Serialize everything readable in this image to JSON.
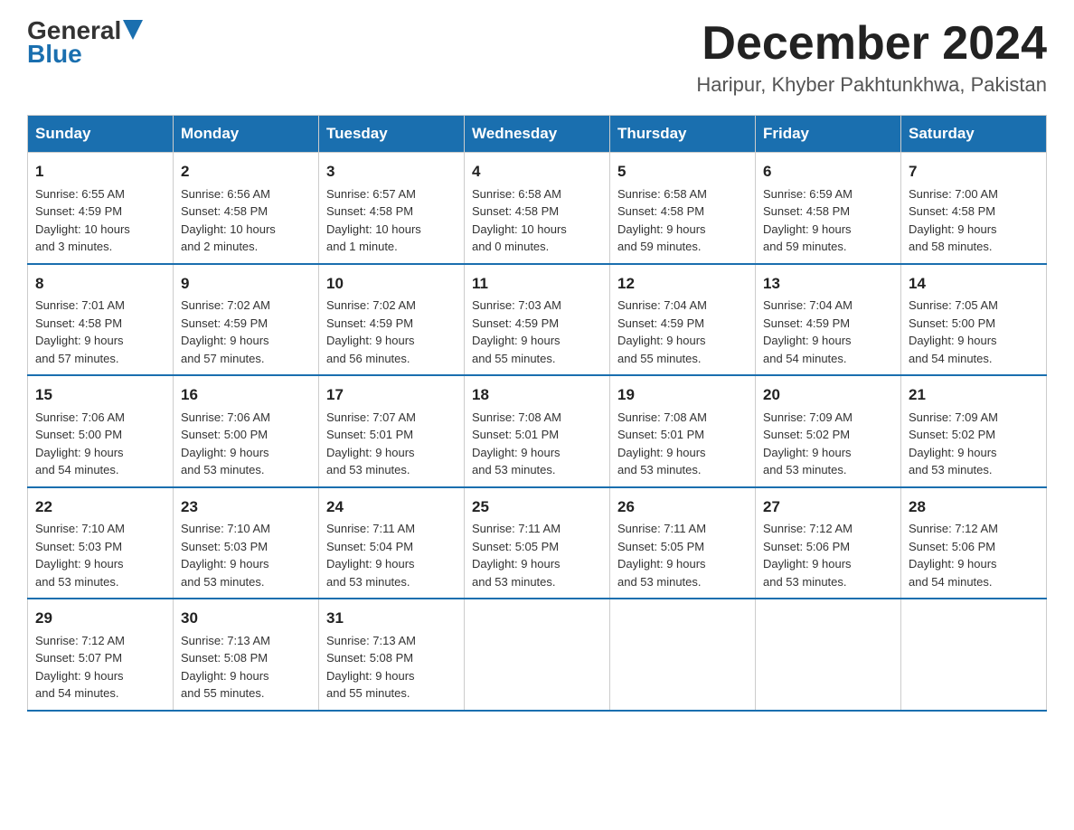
{
  "header": {
    "logo_general": "General",
    "logo_blue": "Blue",
    "month_title": "December 2024",
    "location": "Haripur, Khyber Pakhtunkhwa, Pakistan"
  },
  "days_of_week": [
    "Sunday",
    "Monday",
    "Tuesday",
    "Wednesday",
    "Thursday",
    "Friday",
    "Saturday"
  ],
  "weeks": [
    [
      {
        "day": "1",
        "info": "Sunrise: 6:55 AM\nSunset: 4:59 PM\nDaylight: 10 hours\nand 3 minutes."
      },
      {
        "day": "2",
        "info": "Sunrise: 6:56 AM\nSunset: 4:58 PM\nDaylight: 10 hours\nand 2 minutes."
      },
      {
        "day": "3",
        "info": "Sunrise: 6:57 AM\nSunset: 4:58 PM\nDaylight: 10 hours\nand 1 minute."
      },
      {
        "day": "4",
        "info": "Sunrise: 6:58 AM\nSunset: 4:58 PM\nDaylight: 10 hours\nand 0 minutes."
      },
      {
        "day": "5",
        "info": "Sunrise: 6:58 AM\nSunset: 4:58 PM\nDaylight: 9 hours\nand 59 minutes."
      },
      {
        "day": "6",
        "info": "Sunrise: 6:59 AM\nSunset: 4:58 PM\nDaylight: 9 hours\nand 59 minutes."
      },
      {
        "day": "7",
        "info": "Sunrise: 7:00 AM\nSunset: 4:58 PM\nDaylight: 9 hours\nand 58 minutes."
      }
    ],
    [
      {
        "day": "8",
        "info": "Sunrise: 7:01 AM\nSunset: 4:58 PM\nDaylight: 9 hours\nand 57 minutes."
      },
      {
        "day": "9",
        "info": "Sunrise: 7:02 AM\nSunset: 4:59 PM\nDaylight: 9 hours\nand 57 minutes."
      },
      {
        "day": "10",
        "info": "Sunrise: 7:02 AM\nSunset: 4:59 PM\nDaylight: 9 hours\nand 56 minutes."
      },
      {
        "day": "11",
        "info": "Sunrise: 7:03 AM\nSunset: 4:59 PM\nDaylight: 9 hours\nand 55 minutes."
      },
      {
        "day": "12",
        "info": "Sunrise: 7:04 AM\nSunset: 4:59 PM\nDaylight: 9 hours\nand 55 minutes."
      },
      {
        "day": "13",
        "info": "Sunrise: 7:04 AM\nSunset: 4:59 PM\nDaylight: 9 hours\nand 54 minutes."
      },
      {
        "day": "14",
        "info": "Sunrise: 7:05 AM\nSunset: 5:00 PM\nDaylight: 9 hours\nand 54 minutes."
      }
    ],
    [
      {
        "day": "15",
        "info": "Sunrise: 7:06 AM\nSunset: 5:00 PM\nDaylight: 9 hours\nand 54 minutes."
      },
      {
        "day": "16",
        "info": "Sunrise: 7:06 AM\nSunset: 5:00 PM\nDaylight: 9 hours\nand 53 minutes."
      },
      {
        "day": "17",
        "info": "Sunrise: 7:07 AM\nSunset: 5:01 PM\nDaylight: 9 hours\nand 53 minutes."
      },
      {
        "day": "18",
        "info": "Sunrise: 7:08 AM\nSunset: 5:01 PM\nDaylight: 9 hours\nand 53 minutes."
      },
      {
        "day": "19",
        "info": "Sunrise: 7:08 AM\nSunset: 5:01 PM\nDaylight: 9 hours\nand 53 minutes."
      },
      {
        "day": "20",
        "info": "Sunrise: 7:09 AM\nSunset: 5:02 PM\nDaylight: 9 hours\nand 53 minutes."
      },
      {
        "day": "21",
        "info": "Sunrise: 7:09 AM\nSunset: 5:02 PM\nDaylight: 9 hours\nand 53 minutes."
      }
    ],
    [
      {
        "day": "22",
        "info": "Sunrise: 7:10 AM\nSunset: 5:03 PM\nDaylight: 9 hours\nand 53 minutes."
      },
      {
        "day": "23",
        "info": "Sunrise: 7:10 AM\nSunset: 5:03 PM\nDaylight: 9 hours\nand 53 minutes."
      },
      {
        "day": "24",
        "info": "Sunrise: 7:11 AM\nSunset: 5:04 PM\nDaylight: 9 hours\nand 53 minutes."
      },
      {
        "day": "25",
        "info": "Sunrise: 7:11 AM\nSunset: 5:05 PM\nDaylight: 9 hours\nand 53 minutes."
      },
      {
        "day": "26",
        "info": "Sunrise: 7:11 AM\nSunset: 5:05 PM\nDaylight: 9 hours\nand 53 minutes."
      },
      {
        "day": "27",
        "info": "Sunrise: 7:12 AM\nSunset: 5:06 PM\nDaylight: 9 hours\nand 53 minutes."
      },
      {
        "day": "28",
        "info": "Sunrise: 7:12 AM\nSunset: 5:06 PM\nDaylight: 9 hours\nand 54 minutes."
      }
    ],
    [
      {
        "day": "29",
        "info": "Sunrise: 7:12 AM\nSunset: 5:07 PM\nDaylight: 9 hours\nand 54 minutes."
      },
      {
        "day": "30",
        "info": "Sunrise: 7:13 AM\nSunset: 5:08 PM\nDaylight: 9 hours\nand 55 minutes."
      },
      {
        "day": "31",
        "info": "Sunrise: 7:13 AM\nSunset: 5:08 PM\nDaylight: 9 hours\nand 55 minutes."
      },
      null,
      null,
      null,
      null
    ]
  ]
}
